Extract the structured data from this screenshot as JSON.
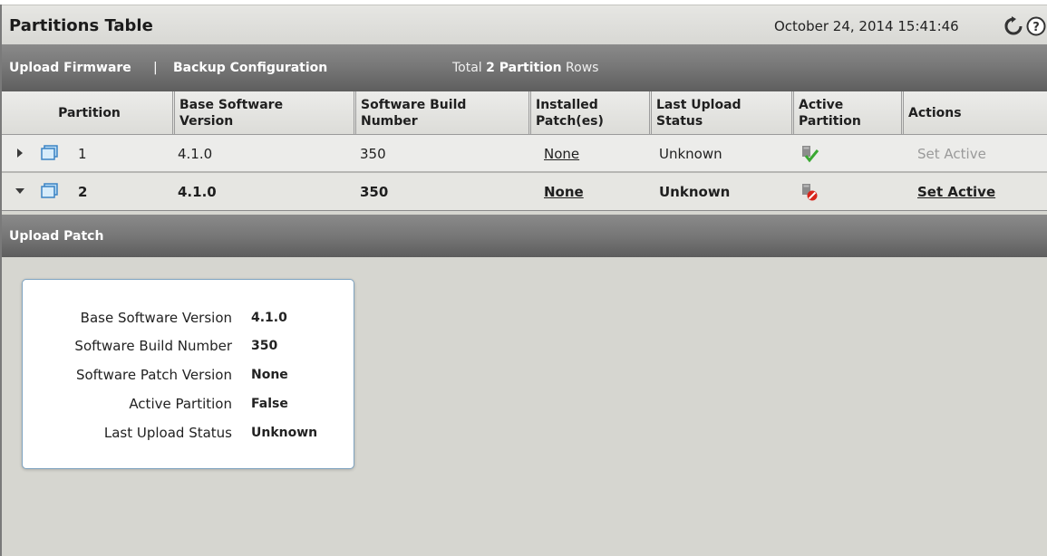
{
  "header": {
    "title": "Partitions Table",
    "timestamp": "October 24, 2014 15:41:46",
    "refresh_icon": "refresh-icon",
    "help_icon": "help-icon"
  },
  "toolbar": {
    "upload_firmware": "Upload Firmware",
    "separator": "|",
    "backup_configuration": "Backup Configuration",
    "total_prefix": "Total",
    "total_count_bold": "2 Partition",
    "total_suffix": "Rows"
  },
  "table": {
    "columns": [
      "Partition",
      "Base Software Version",
      "Software Build Number",
      "Installed Patch(es)",
      "Last Upload Status",
      "Active Partition",
      "Actions"
    ],
    "column_lines": [
      [
        "Partition"
      ],
      [
        "Base Software",
        "Version"
      ],
      [
        "Software Build",
        "Number"
      ],
      [
        "Installed",
        "Patch(es)"
      ],
      [
        "Last Upload",
        "Status"
      ],
      [
        "Active",
        "Partition"
      ],
      [
        "Actions"
      ]
    ],
    "rows": [
      {
        "partition": "1",
        "expanded": false,
        "base_version": "4.1.0",
        "build": "350",
        "patches": "None",
        "upload_status": "Unknown",
        "active_icon": "active-check-icon",
        "action": "Set Active",
        "action_enabled": false
      },
      {
        "partition": "2",
        "expanded": true,
        "base_version": "4.1.0",
        "build": "350",
        "patches": "None",
        "upload_status": "Unknown",
        "active_icon": "inactive-no-icon",
        "action": "Set Active",
        "action_enabled": true
      }
    ]
  },
  "patch_bar": {
    "label": "Upload Patch"
  },
  "details": {
    "fields": [
      {
        "label": "Base Software Version",
        "value": "4.1.0"
      },
      {
        "label": "Software Build Number",
        "value": "350"
      },
      {
        "label": "Software Patch Version",
        "value": "None"
      },
      {
        "label": "Active Partition",
        "value": "False"
      },
      {
        "label": "Last Upload Status",
        "value": "Unknown"
      }
    ]
  },
  "colors": {
    "toolbar": "#777777",
    "background": "#d6d6d0",
    "card_border": "#7fa3c0",
    "check_green": "#3aa832",
    "no_red": "#d8261c"
  }
}
